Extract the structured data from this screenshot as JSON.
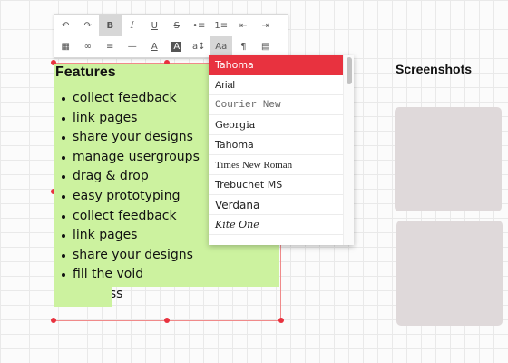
{
  "textbox": {
    "title": "Features",
    "items": [
      "collect feedback",
      "link pages",
      "share your designs",
      "manage usergroups",
      "drag & drop",
      "easy prototyping",
      "collect feedback",
      "link pages",
      "share your designs",
      "fill the void",
      "kick ass"
    ]
  },
  "toolbar": {
    "row1": [
      {
        "name": "undo-icon",
        "glyph": "↶"
      },
      {
        "name": "redo-icon",
        "glyph": "↷"
      },
      {
        "name": "bold-icon",
        "glyph": "B",
        "active": true
      },
      {
        "name": "italic-icon",
        "glyph": "I"
      },
      {
        "name": "underline-icon",
        "glyph": "U"
      },
      {
        "name": "strikethrough-icon",
        "glyph": "S"
      },
      {
        "name": "bulleted-list-icon",
        "glyph": "•≡"
      },
      {
        "name": "numbered-list-icon",
        "glyph": "1≡"
      },
      {
        "name": "outdent-icon",
        "glyph": "⇤"
      },
      {
        "name": "indent-icon",
        "glyph": "⇥"
      }
    ],
    "row2": [
      {
        "name": "table-icon",
        "glyph": "▦"
      },
      {
        "name": "link-icon",
        "glyph": "∞"
      },
      {
        "name": "align-left-icon",
        "glyph": "≡"
      },
      {
        "name": "horizontal-rule-icon",
        "glyph": "—"
      },
      {
        "name": "text-color-icon",
        "glyph": "A"
      },
      {
        "name": "highlight-color-icon",
        "glyph": "A"
      },
      {
        "name": "font-size-icon",
        "glyph": "a↕"
      },
      {
        "name": "font-family-icon",
        "glyph": "Aa",
        "active": true
      },
      {
        "name": "paragraph-format-icon",
        "glyph": "¶"
      },
      {
        "name": "clear-format-icon",
        "glyph": "▤"
      }
    ]
  },
  "font_dropdown": {
    "selected": "Tahoma",
    "options": [
      "Tahoma",
      "Arial",
      "Courier New",
      "Georgia",
      "Tahoma",
      "Times New Roman",
      "Trebuchet MS",
      "Verdana",
      "Kite One"
    ]
  },
  "screenshots": {
    "title": "Screenshots"
  },
  "colors": {
    "accent": "#e8323f",
    "text_bg": "#ccf29f",
    "placeholder": "#dfd9da"
  }
}
